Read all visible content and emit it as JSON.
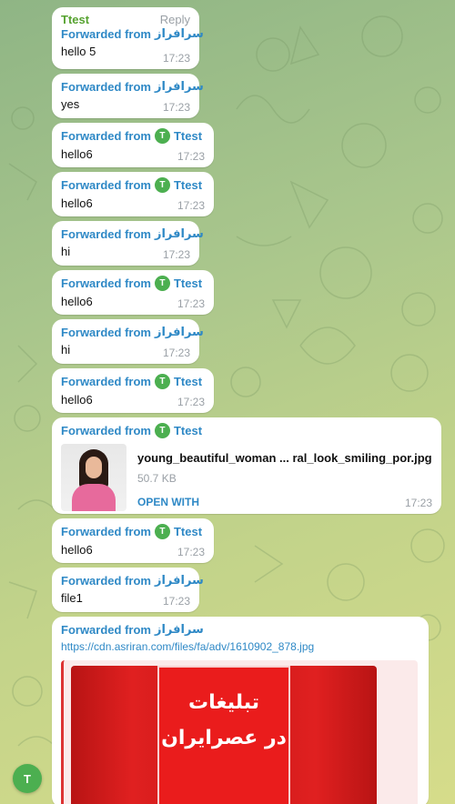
{
  "messages": [
    {
      "sender": "Ttest",
      "reply": "Reply",
      "fwd_prefix": "Forwarded from",
      "fwd_name": "سرافراز",
      "text": "hello 5",
      "time": "17:23"
    },
    {
      "fwd_prefix": "Forwarded from",
      "fwd_name": "سرافراز",
      "text": "yes",
      "time": "17:23"
    },
    {
      "fwd_prefix": "Forwarded from",
      "fwd_avatar": "T",
      "fwd_name": "Ttest",
      "text": "hello6",
      "time": "17:23"
    },
    {
      "fwd_prefix": "Forwarded from",
      "fwd_avatar": "T",
      "fwd_name": "Ttest",
      "text": "hello6",
      "time": "17:23"
    },
    {
      "fwd_prefix": "Forwarded from",
      "fwd_name": "سرافراز",
      "text": "hi",
      "time": "17:23"
    },
    {
      "fwd_prefix": "Forwarded from",
      "fwd_avatar": "T",
      "fwd_name": "Ttest",
      "text": "hello6",
      "time": "17:23"
    },
    {
      "fwd_prefix": "Forwarded from",
      "fwd_name": "سرافراز",
      "text": "hi",
      "time": "17:23"
    },
    {
      "fwd_prefix": "Forwarded from",
      "fwd_avatar": "T",
      "fwd_name": "Ttest",
      "text": "hello6",
      "time": "17:23"
    },
    {
      "fwd_prefix": "Forwarded from",
      "fwd_avatar": "T",
      "fwd_name": "Ttest",
      "file_name": "young_beautiful_woman ... ral_look_smiling_por.jpg",
      "file_size": "50.7 KB",
      "open_with": "OPEN WITH",
      "time": "17:23"
    },
    {
      "fwd_prefix": "Forwarded from",
      "fwd_avatar": "T",
      "fwd_name": "Ttest",
      "text": "hello6",
      "time": "17:23"
    },
    {
      "fwd_prefix": "Forwarded from",
      "fwd_name": "سرافراز",
      "text": "file1",
      "time": "17:23"
    },
    {
      "fwd_prefix": "Forwarded from",
      "fwd_name": "سرافراز",
      "link": "https://cdn.asriran.com/files/fa/adv/1610902_878.jpg",
      "preview_line1": "تبليغات",
      "preview_line2": "در عصرايران"
    }
  ],
  "fab": {
    "initial": "T"
  },
  "colors": {
    "sender": "#57a331",
    "forward": "#2f89c6",
    "time": "#9aa0a6",
    "avatar": "#4caf50"
  }
}
